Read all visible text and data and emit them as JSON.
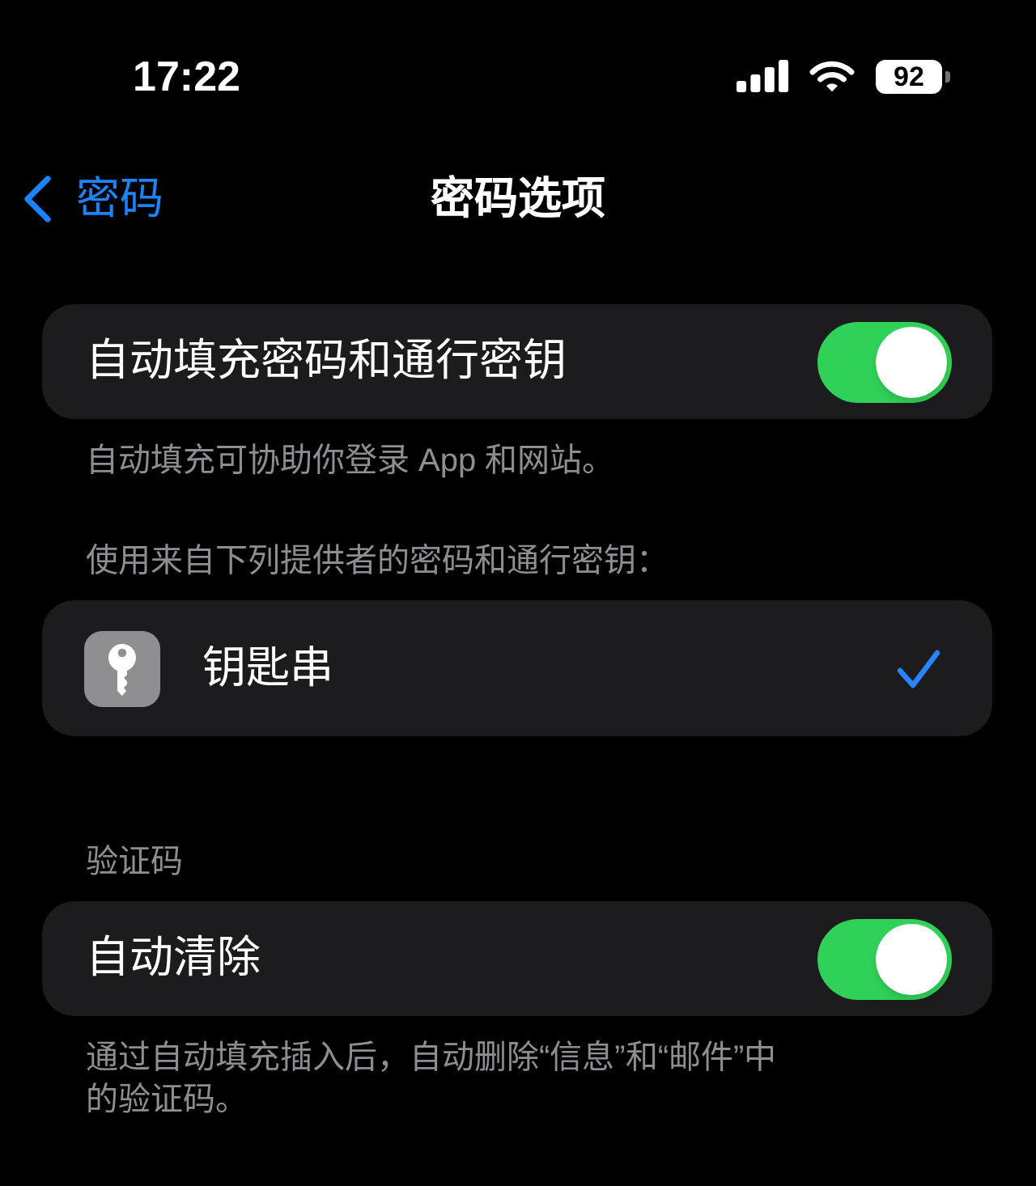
{
  "status_bar": {
    "time": "17:22",
    "battery": "92"
  },
  "nav_bar": {
    "back": "密码",
    "title": "密码选项"
  },
  "sections": [
    {
      "rows": [
        {
          "kind": "toggle",
          "label": "自动填充密码和通行密钥",
          "on": true
        }
      ],
      "footer": "自动填充可协助你登录 App 和网站。"
    },
    {
      "header": "使用来自下列提供者的密码和通行密钥：",
      "rows": [
        {
          "kind": "provider",
          "label": "钥匙串",
          "selected": true
        }
      ]
    },
    {
      "header": "验证码",
      "rows": [
        {
          "kind": "toggle",
          "label": "自动清除",
          "on": true
        }
      ],
      "footer": "通过自动填充插入后，自动删除“信息”和“邮件”中的验证码。"
    }
  ]
}
